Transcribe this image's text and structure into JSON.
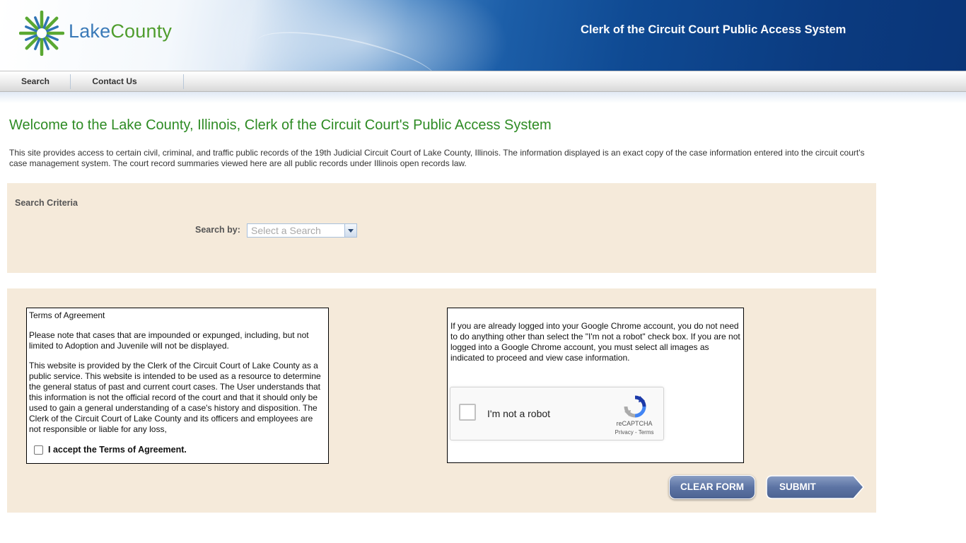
{
  "header": {
    "logo_lake": "Lake",
    "logo_county": "County",
    "title": "Clerk of the Circuit Court Public Access System"
  },
  "nav": {
    "items": [
      {
        "label": "Search"
      },
      {
        "label": "Contact Us"
      }
    ]
  },
  "main": {
    "title": "Welcome to the Lake County, Illinois, Clerk of the Circuit Court's Public Access System",
    "intro": "This site provides access to certain civil, criminal, and traffic public records of the 19th Judicial Circuit Court of Lake County, Illinois. The information displayed is an exact copy of the case information entered into the circuit court's case management system. The court record summaries viewed here are all public records under Illinois open records law."
  },
  "search_criteria": {
    "heading": "Search Criteria",
    "search_by_label": "Search by:",
    "select_placeholder": "Select a Search"
  },
  "terms": {
    "heading": "Terms of Agreement",
    "paragraph1": "Please note that cases that are impounded or expunged, including, but not limited to Adoption and Juvenile will not be displayed.",
    "paragraph2": "This website is provided by the Clerk of the Circuit Court of Lake County as a public service. This website is intended to be used as a resource to determine the general status of past and current court cases. The User understands that this information is not the official record of the court and that it should only be used to gain a general understanding of a case's history and disposition. The Clerk of the Circuit Court of Lake County and its officers and employees are not responsible or liable for any loss,",
    "accept_label": "I accept the Terms of Agreement."
  },
  "captcha": {
    "instructions": "If you are already logged into your Google Chrome account, you do not need to do anything other than select the \"I'm not a robot\" check box. If you are not logged into a Google Chrome account, you must select all images as indicated to proceed and view case information.",
    "checkbox_label": "I'm not a robot",
    "brand": "reCAPTCHA",
    "privacy": "Privacy",
    "separator": " - ",
    "terms": "Terms"
  },
  "buttons": {
    "clear": "CLEAR FORM",
    "submit": "SUBMIT"
  },
  "colors": {
    "title_green": "#2e8b24",
    "panel_beige": "#f5eada",
    "button_blue": "#5d74a4",
    "header_navy": "#0a3578"
  }
}
